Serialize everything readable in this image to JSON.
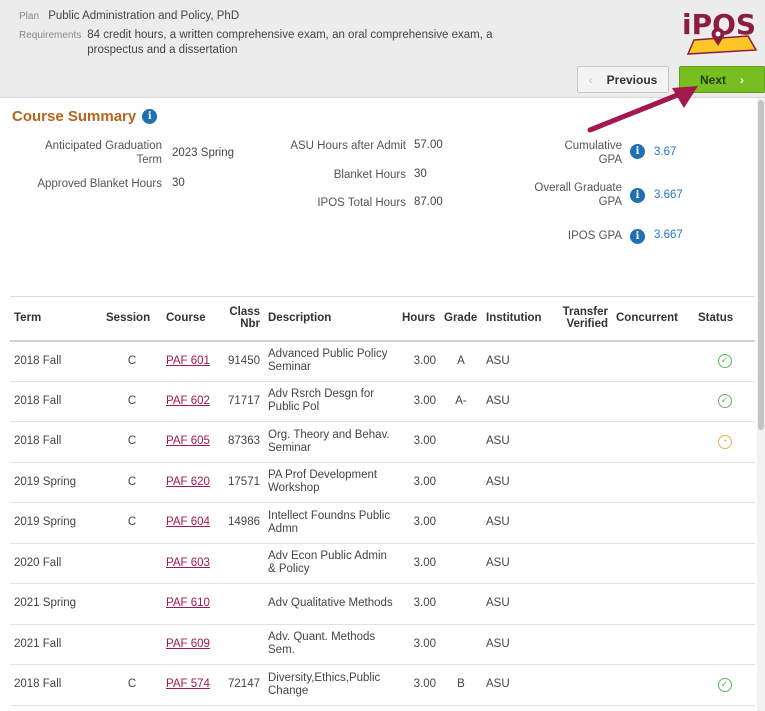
{
  "header": {
    "plan_label": "Plan",
    "plan_value": "Public Administration and Policy, PhD",
    "requirements_label": "Requirements",
    "requirements_value": "84 credit hours, a written comprehensive exam, an oral comprehensive exam, a prospectus and a dissertation",
    "logo_text": "iPOS",
    "previous_label": "Previous",
    "next_label": "Next",
    "arrow_color": "#a3184f"
  },
  "summary": {
    "title": "Course Summary",
    "anticipated_graduation_label": "Anticipated Graduation Term",
    "anticipated_graduation_value": "2023 Spring",
    "approved_blanket_hours_label": "Approved Blanket Hours",
    "approved_blanket_hours_value": "30",
    "asu_hours_after_admit_label": "ASU Hours after Admit",
    "asu_hours_after_admit_value": "57.00",
    "blanket_hours_label": "Blanket Hours",
    "blanket_hours_value": "30",
    "ipos_total_hours_label": "IPOS Total Hours",
    "ipos_total_hours_value": "87.00",
    "cumulative_gpa_label": "Cumulative GPA",
    "cumulative_gpa_value": "3.67",
    "overall_graduate_gpa_label": "Overall Graduate GPA",
    "overall_graduate_gpa_value": "3.667",
    "ipos_gpa_label": "IPOS GPA",
    "ipos_gpa_value": "3.667"
  },
  "table": {
    "headers": {
      "term": "Term",
      "session": "Session",
      "course": "Course",
      "class_nbr": "Class Nbr",
      "description": "Description",
      "hours": "Hours",
      "grade": "Grade",
      "institution": "Institution",
      "transfer_verified": "Transfer Verified",
      "concurrent": "Concurrent",
      "status": "Status"
    },
    "rows": [
      {
        "term": "2018 Fall",
        "session": "C",
        "course": "PAF 601",
        "class_nbr": "91450",
        "description": "Advanced Public Policy Seminar",
        "hours": "3.00",
        "grade": "A",
        "institution": "ASU",
        "status": "complete"
      },
      {
        "term": "2018 Fall",
        "session": "C",
        "course": "PAF 602",
        "class_nbr": "71717",
        "description": "Adv Rsrch Desgn for Public Pol",
        "hours": "3.00",
        "grade": "A-",
        "institution": "ASU",
        "status": "complete"
      },
      {
        "term": "2018 Fall",
        "session": "C",
        "course": "PAF 605",
        "class_nbr": "87363",
        "description": "Org. Theory and Behav. Seminar",
        "hours": "3.00",
        "grade": "",
        "institution": "ASU",
        "status": "pending"
      },
      {
        "term": "2019 Spring",
        "session": "C",
        "course": "PAF 620",
        "class_nbr": "17571",
        "description": "PA Prof Development Workshop",
        "hours": "3.00",
        "grade": "",
        "institution": "ASU",
        "status": ""
      },
      {
        "term": "2019 Spring",
        "session": "C",
        "course": "PAF 604",
        "class_nbr": "14986",
        "description": "Intellect Foundns Public Admn",
        "hours": "3.00",
        "grade": "",
        "institution": "ASU",
        "status": ""
      },
      {
        "term": "2020 Fall",
        "session": "",
        "course": "PAF 603",
        "class_nbr": "",
        "description": "Adv Econ Public Admin & Policy",
        "hours": "3.00",
        "grade": "",
        "institution": "ASU",
        "status": ""
      },
      {
        "term": "2021 Spring",
        "session": "",
        "course": "PAF 610",
        "class_nbr": "",
        "description": "Adv Qualitative Methods",
        "hours": "3.00",
        "grade": "",
        "institution": "ASU",
        "status": ""
      },
      {
        "term": "2021 Fall",
        "session": "",
        "course": "PAF 609",
        "class_nbr": "",
        "description": "Adv. Quant. Methods Sem.",
        "hours": "3.00",
        "grade": "",
        "institution": "ASU",
        "status": ""
      },
      {
        "term": "2018 Fall",
        "session": "C",
        "course": "PAF 574",
        "class_nbr": "72147",
        "description": "Diversity,Ethics,Public Change",
        "hours": "3.00",
        "grade": "B",
        "institution": "ASU",
        "status": "complete"
      }
    ]
  }
}
